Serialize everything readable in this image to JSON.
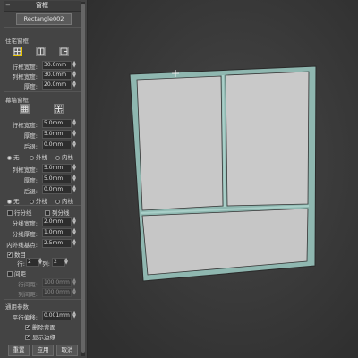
{
  "panel": {
    "title": "窗框",
    "object_name": "Rectangle002",
    "sec1": {
      "heading": "住宅窗框",
      "fields": [
        {
          "label": "行框宽度:",
          "value": "30.0mm"
        },
        {
          "label": "列框宽度:",
          "value": "30.0mm"
        },
        {
          "label": "厚度:",
          "value": "20.0mm"
        }
      ]
    },
    "sec2": {
      "heading": "幕墙窗框",
      "groupA": [
        {
          "label": "行框宽度:",
          "value": "5.0mm"
        },
        {
          "label": "厚度:",
          "value": "5.0mm"
        },
        {
          "label": "后退:",
          "value": "0.0mm"
        }
      ],
      "radioA": [
        "无",
        "外栈",
        "内栈"
      ],
      "groupB": [
        {
          "label": "列框宽度:",
          "value": "5.0mm"
        },
        {
          "label": "厚度:",
          "value": "5.0mm"
        },
        {
          "label": "后退:",
          "value": "0.0mm"
        }
      ],
      "radioB": [
        "无",
        "外栈",
        "内栈"
      ]
    },
    "sec3": {
      "row_split": "行分线",
      "col_split": "列分线",
      "fields": [
        {
          "label": "分线宽度:",
          "value": "2.0mm"
        },
        {
          "label": "分线厚度:",
          "value": "1.0mm"
        },
        {
          "label": "内外线基点:",
          "value": "2.5mm"
        }
      ],
      "count_check": "数目",
      "row_label": "行:",
      "row_value": "2",
      "col_label": "列:",
      "col_value": "2",
      "spacing_check": "间距",
      "row_spacing_label": "行间距:",
      "row_spacing_value": "100.0mm",
      "col_spacing_label": "列间距:",
      "col_spacing_value": "100.0mm"
    },
    "sec4": {
      "heading": "通用参数",
      "offset_label": "平行偏移:",
      "offset_value": "0.001mm",
      "check1": "删除背面",
      "check2": "显示边缘"
    },
    "buttons": {
      "reset": "重置",
      "apply": "应用",
      "cancel": "取消"
    }
  },
  "colors": {
    "accent_border": "#e8c400",
    "frame": "#8fb7b0",
    "glass": "#c8c8c8"
  }
}
